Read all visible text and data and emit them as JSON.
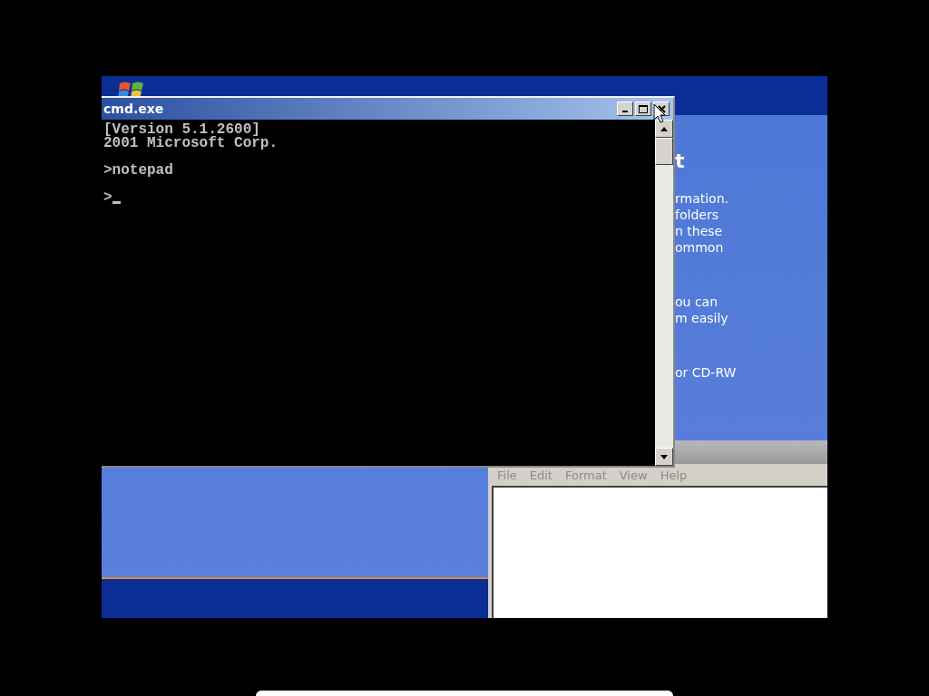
{
  "welcome_window": {
    "heading": "t",
    "paragraphs": [
      [
        "rmation.",
        "folders",
        "n these",
        "ommon"
      ],
      [
        "ou can",
        "m easily"
      ],
      [
        "or CD-RW"
      ]
    ]
  },
  "cmd_window": {
    "title": "cmd.exe",
    "blocks": [
      [
        "[Version 5.1.2600]",
        "2001 Microsoft Corp."
      ],
      [
        ">notepad"
      ],
      [
        ">"
      ]
    ]
  },
  "notepad": {
    "menu": [
      "File",
      "Edit",
      "Format",
      "View",
      "Help"
    ]
  }
}
